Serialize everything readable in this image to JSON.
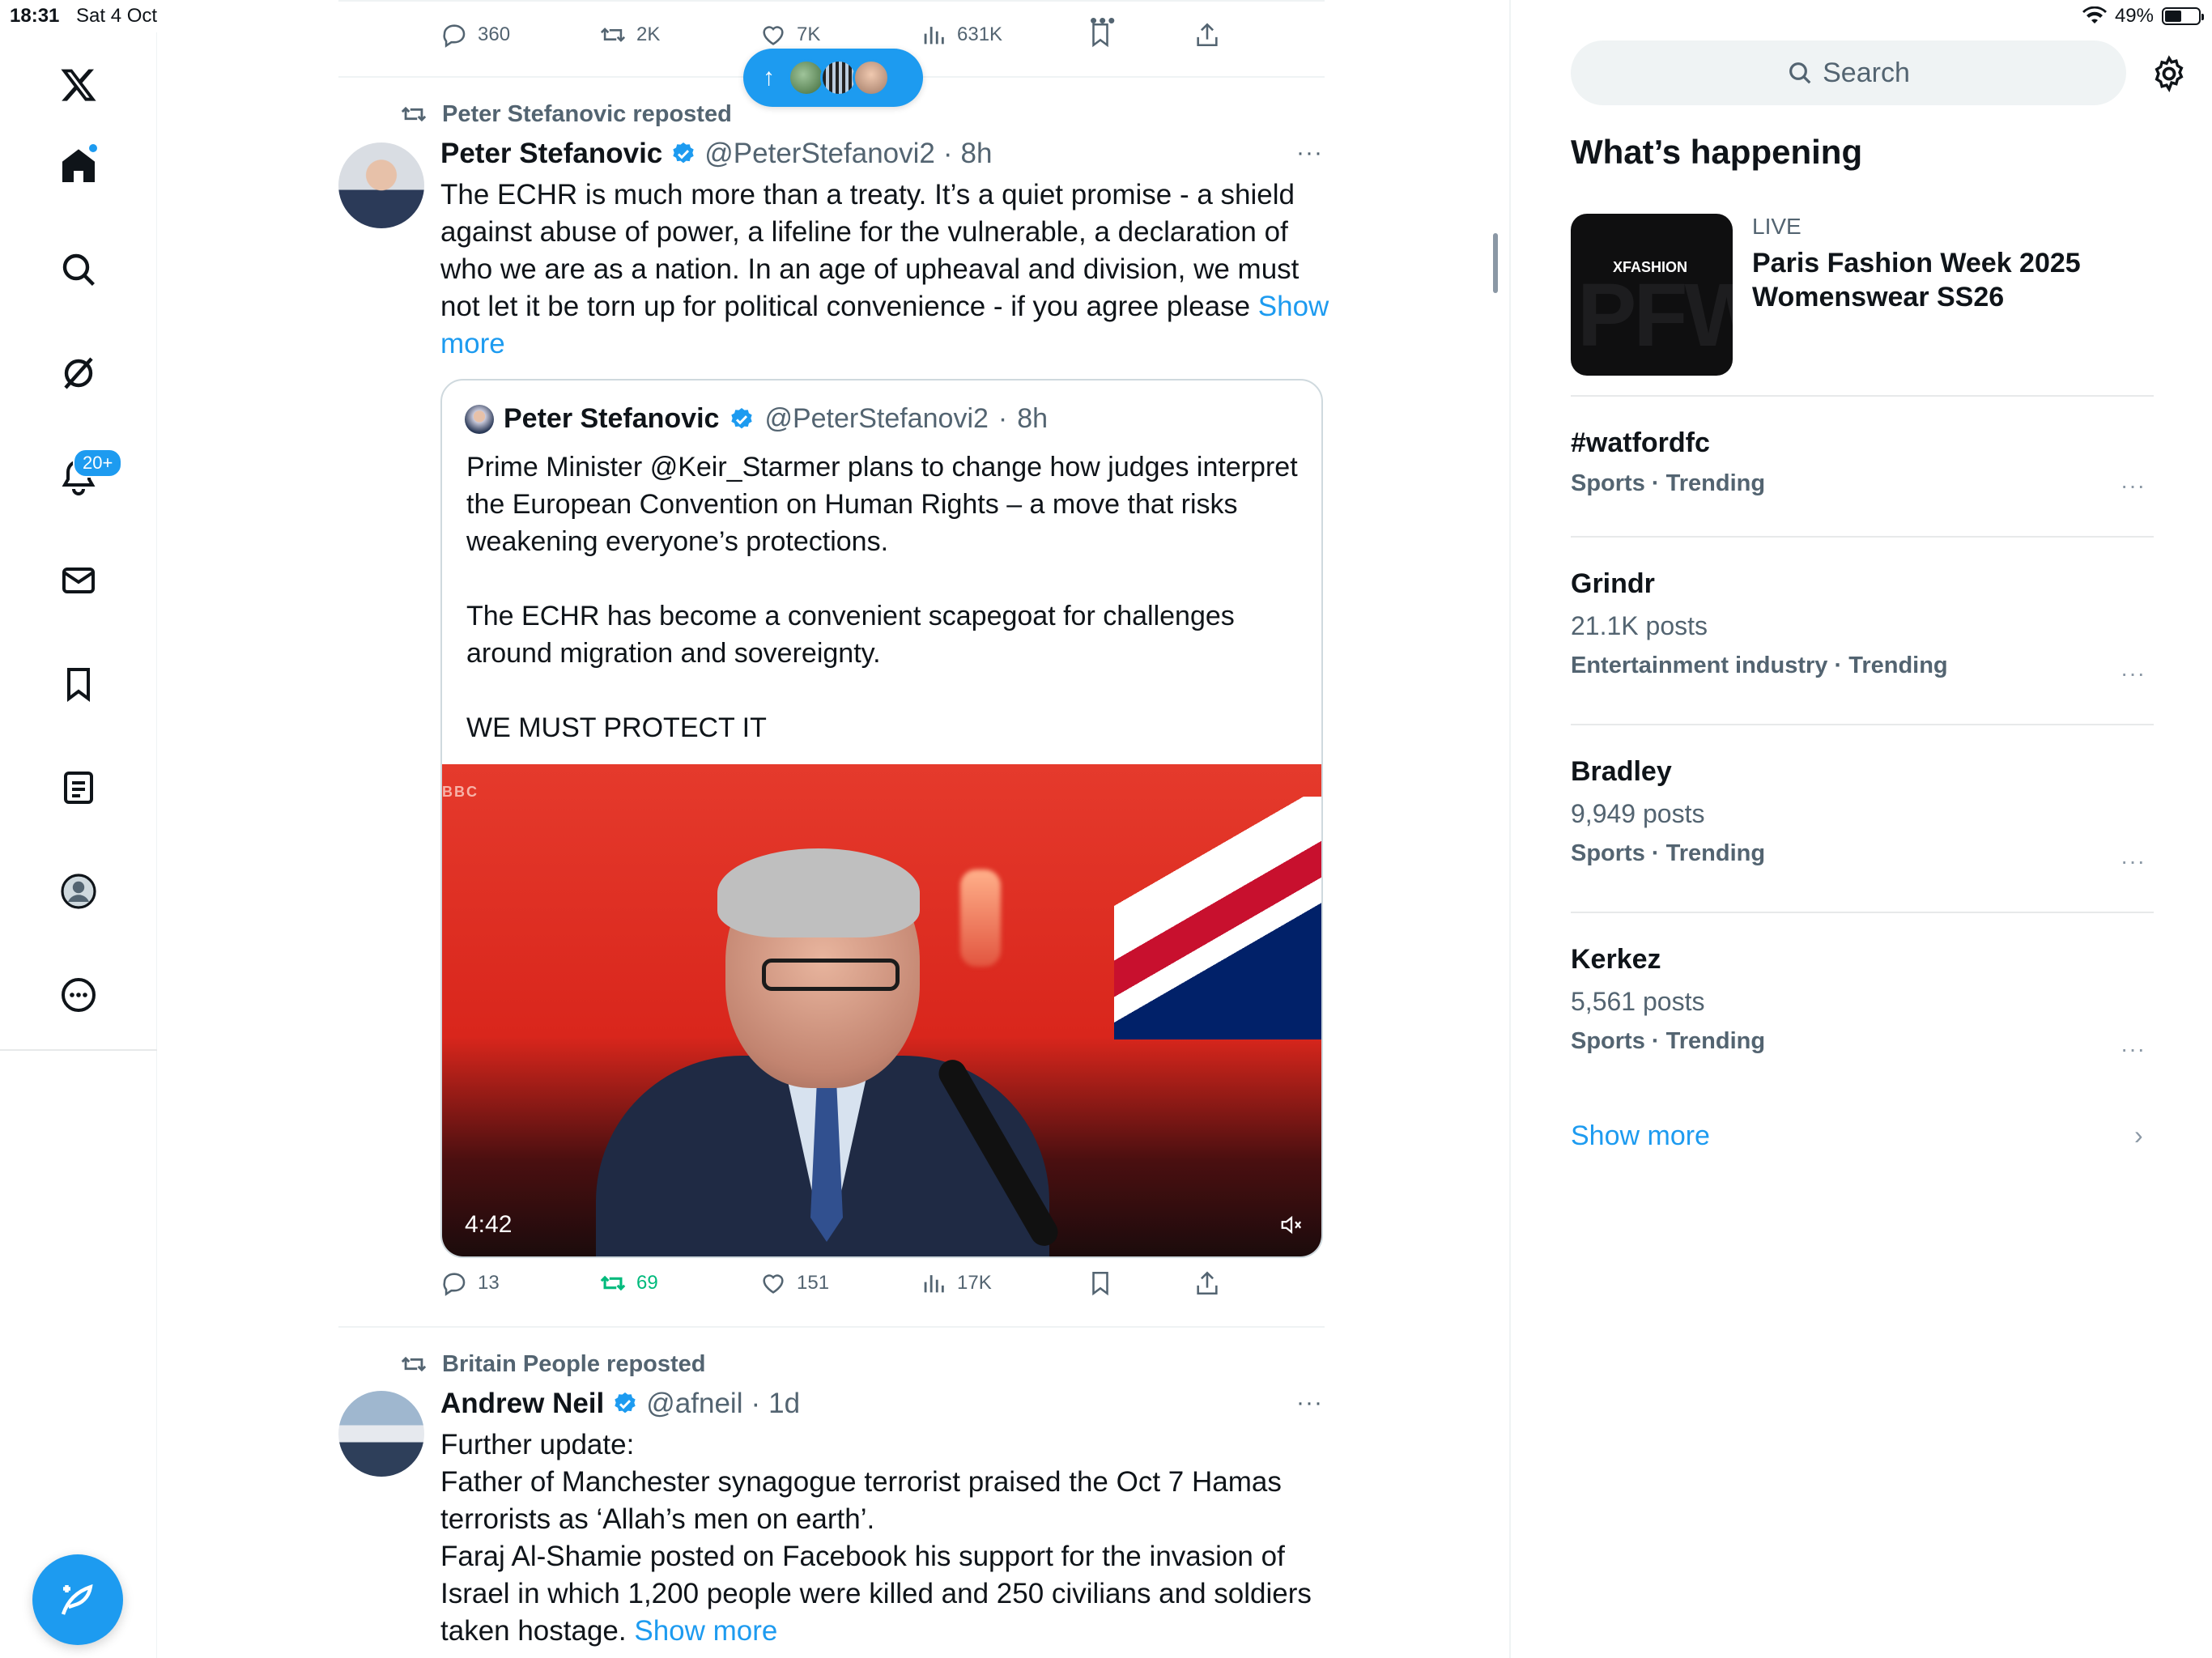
{
  "status_bar": {
    "time": "18:31",
    "date": "Sat 4 Oct",
    "battery": "49%",
    "battery_level": 0.49
  },
  "left_nav": {
    "items": [
      {
        "name": "x-logo",
        "icon": "x-logo-icon"
      },
      {
        "name": "home",
        "icon": "home-icon",
        "dot": true
      },
      {
        "name": "explore",
        "icon": "search-icon"
      },
      {
        "name": "grok",
        "icon": "grok-icon"
      },
      {
        "name": "notifications",
        "icon": "bell-icon",
        "badge": "20+"
      },
      {
        "name": "messages",
        "icon": "mail-icon"
      },
      {
        "name": "bookmarks",
        "icon": "bookmark-icon"
      },
      {
        "name": "lists",
        "icon": "list-icon"
      },
      {
        "name": "profile",
        "icon": "profile-icon"
      },
      {
        "name": "more",
        "icon": "more-icon"
      }
    ],
    "compose_icon": "compose-icon"
  },
  "feed": {
    "top_actions": {
      "replies": "360",
      "reposts": "2K",
      "likes": "7K",
      "views": "631K"
    },
    "post1": {
      "repost_label": "Peter Stefanovic reposted",
      "name": "Peter Stefanovic",
      "handle": "@PeterStefanovi2",
      "sep": "·",
      "time": "8h",
      "text": "The ECHR is much more than a treaty. It’s a quiet promise - a shield against abuse of power, a lifeline for the vulnerable, a declaration of who we are as a nation. In an age of upheaval and division, we must not let it be torn up for political convenience - if you agree please ",
      "show_more": "Show more",
      "quote": {
        "name": "Peter Stefanovic",
        "handle": "@PeterStefanovi2",
        "sep": "·",
        "time": "8h",
        "text": "Prime Minister @Keir_Starmer plans to change how judges interpret the European Convention on Human Rights – a move that risks weakening everyone’s protections.\n\nThe ECHR has become a convenient scapegoat for challenges around migration and sovereignty.\n\nWE MUST PROTECT IT",
        "video_duration": "4:42",
        "video_watermark": "BBC"
      },
      "actions": {
        "replies": "13",
        "reposts": "69",
        "likes": "151",
        "views": "17K"
      }
    },
    "post2": {
      "repost_label": "Britain People reposted",
      "name": "Andrew Neil",
      "handle": "@afneil",
      "sep": "·",
      "time": "1d",
      "text": "Further update:\nFather of Manchester synagogue terrorist praised the Oct 7 Hamas terrorists as ‘Allah’s men on earth’.\nFaraj Al-Shamie posted on Facebook his support for the invasion of Israel in which 1,200 people were killed and 250 civilians and soldiers taken hostage. ",
      "show_more": "Show more"
    }
  },
  "sidebar": {
    "search_placeholder": "Search",
    "title": "What’s happening",
    "event": {
      "live": "LIVE",
      "title": "Paris Fashion Week 2025 Womenswear SS26",
      "thumb_label": "XFASHION",
      "thumb_big": "PFW"
    },
    "trends": [
      {
        "name": "#watfordfc",
        "posts": "",
        "category": "Sports · Trending"
      },
      {
        "name": "Grindr",
        "posts": "21.1K posts",
        "category": "Entertainment industry · Trending"
      },
      {
        "name": "Bradley",
        "posts": "9,949 posts",
        "category": "Sports · Trending"
      },
      {
        "name": "Kerkez",
        "posts": "5,561 posts",
        "category": "Sports · Trending"
      }
    ],
    "show_more": "Show more"
  },
  "colors": {
    "accent": "#1d9bf0",
    "repost_green": "#00ba7c",
    "muted": "#536471"
  }
}
